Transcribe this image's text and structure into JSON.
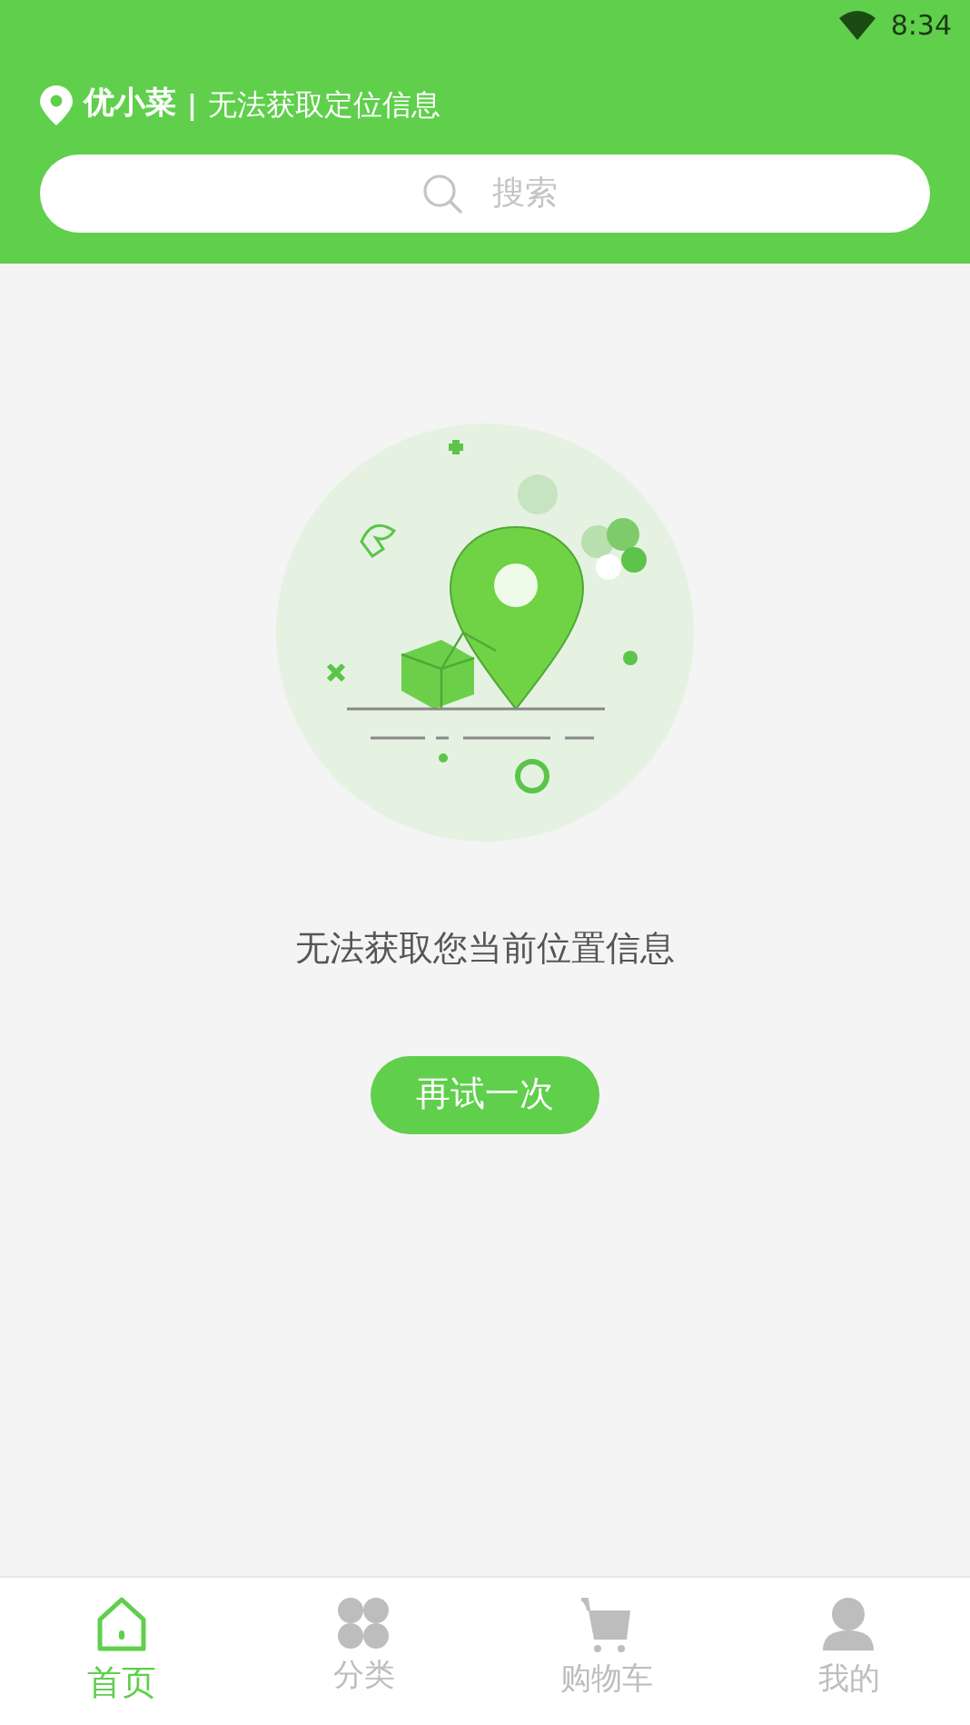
{
  "status_bar": {
    "time": "8:34"
  },
  "header": {
    "app_name": "优小菜",
    "separator": "|",
    "location_status": "无法获取定位信息"
  },
  "search": {
    "placeholder": "搜索"
  },
  "message": "无法获取您当前位置信息",
  "retry_button": "再试一次",
  "bottom_nav": [
    {
      "label": "首页",
      "selected": true
    },
    {
      "label": "分类",
      "selected": false
    },
    {
      "label": "购物车",
      "selected": false
    },
    {
      "label": "我的",
      "selected": false
    }
  ]
}
